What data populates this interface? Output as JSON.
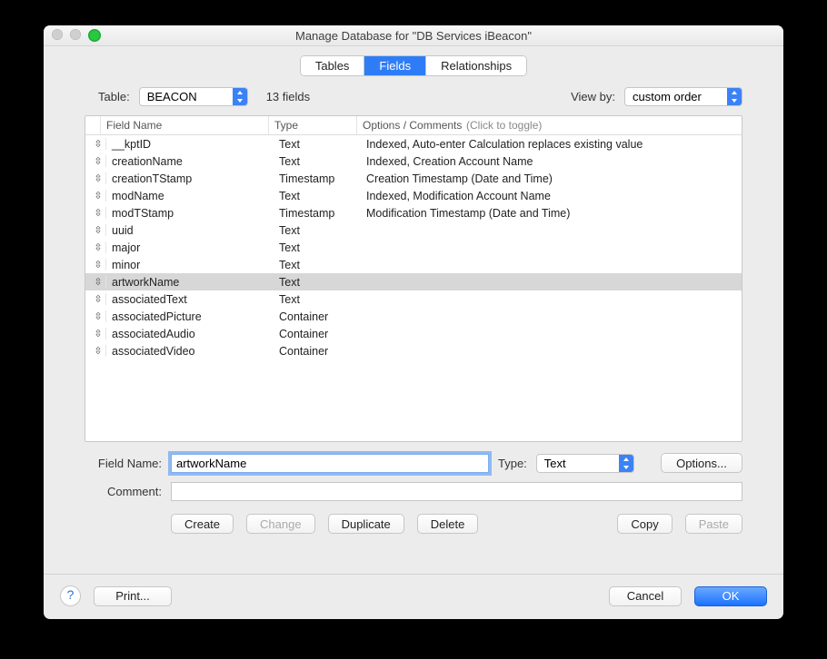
{
  "window": {
    "title": "Manage Database for \"DB Services iBeacon\""
  },
  "tabs": {
    "items": [
      {
        "label": "Tables",
        "active": false
      },
      {
        "label": "Fields",
        "active": true
      },
      {
        "label": "Relationships",
        "active": false
      }
    ]
  },
  "top": {
    "table_label": "Table:",
    "table_value": "BEACON",
    "field_count": "13 fields",
    "viewby_label": "View by:",
    "viewby_value": "custom order"
  },
  "columns": {
    "name": "Field Name",
    "type": "Type",
    "opts": "Options / Comments",
    "opts_hint": "(Click to toggle)"
  },
  "rows": [
    {
      "name": "__kptID",
      "type": "Text",
      "opts": "Indexed, Auto-enter Calculation replaces existing value",
      "selected": false
    },
    {
      "name": "creationName",
      "type": "Text",
      "opts": "Indexed, Creation Account Name",
      "selected": false
    },
    {
      "name": "creationTStamp",
      "type": "Timestamp",
      "opts": "Creation Timestamp (Date and Time)",
      "selected": false
    },
    {
      "name": "modName",
      "type": "Text",
      "opts": "Indexed, Modification Account Name",
      "selected": false
    },
    {
      "name": "modTStamp",
      "type": "Timestamp",
      "opts": "Modification Timestamp (Date and Time)",
      "selected": false
    },
    {
      "name": "uuid",
      "type": "Text",
      "opts": "",
      "selected": false
    },
    {
      "name": "major",
      "type": "Text",
      "opts": "",
      "selected": false
    },
    {
      "name": "minor",
      "type": "Text",
      "opts": "",
      "selected": false
    },
    {
      "name": "artworkName",
      "type": "Text",
      "opts": "",
      "selected": true
    },
    {
      "name": "associatedText",
      "type": "Text",
      "opts": "",
      "selected": false
    },
    {
      "name": "associatedPicture",
      "type": "Container",
      "opts": "",
      "selected": false
    },
    {
      "name": "associatedAudio",
      "type": "Container",
      "opts": "",
      "selected": false
    },
    {
      "name": "associatedVideo",
      "type": "Container",
      "opts": "",
      "selected": false
    }
  ],
  "form": {
    "fieldname_label": "Field Name:",
    "fieldname_value": "artworkName",
    "type_label": "Type:",
    "type_value": "Text",
    "options_label": "Options...",
    "comment_label": "Comment:",
    "comment_value": ""
  },
  "actions": {
    "create": "Create",
    "change": "Change",
    "duplicate": "Duplicate",
    "delete": "Delete",
    "copy": "Copy",
    "paste": "Paste"
  },
  "footer": {
    "print": "Print...",
    "cancel": "Cancel",
    "ok": "OK"
  }
}
